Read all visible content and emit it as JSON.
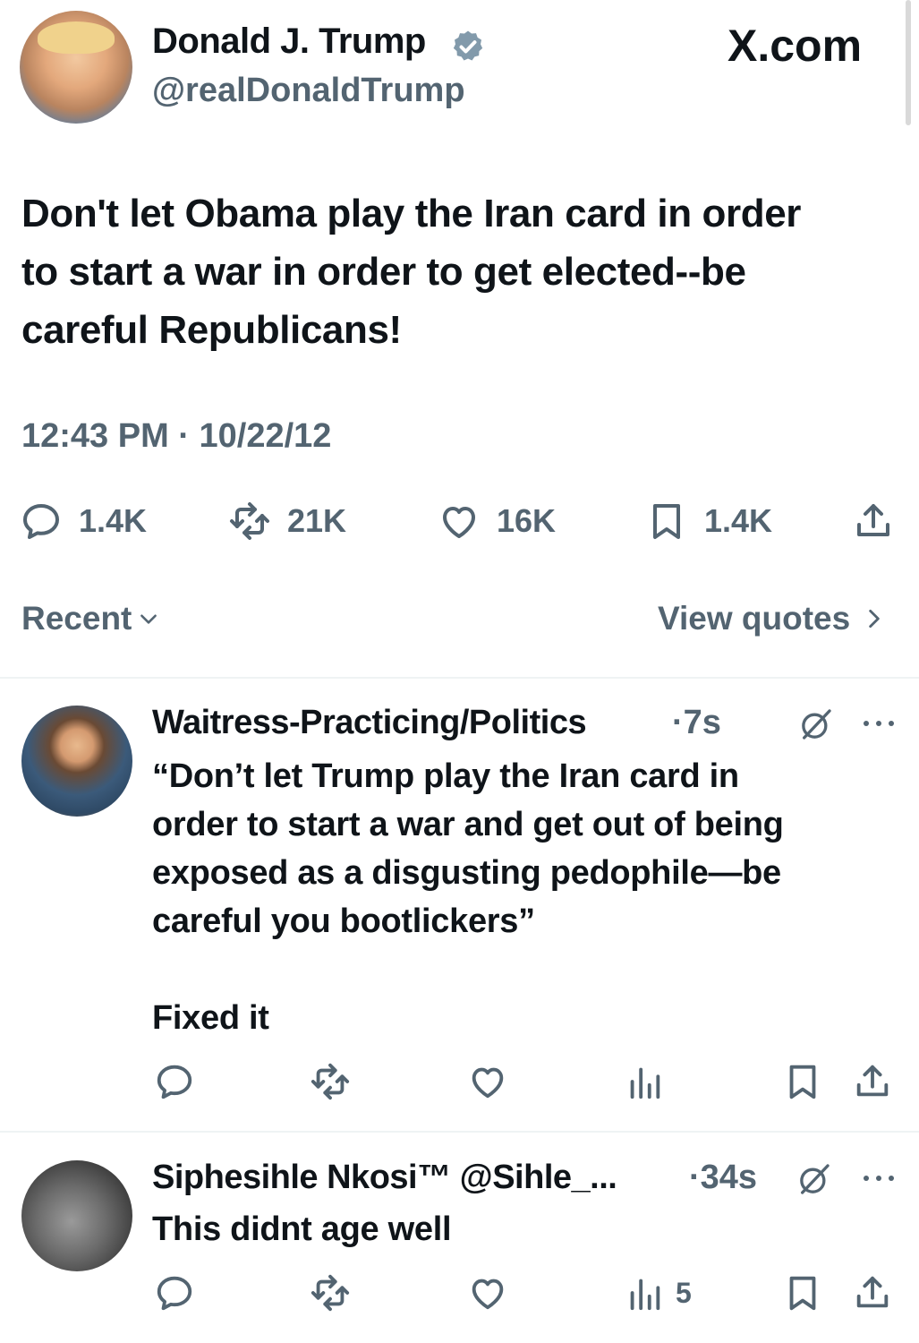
{
  "main_tweet": {
    "author_name": "Donald J. Trump",
    "handle": "@realDonaldTrump",
    "site_label": "X.com",
    "text_lines": [
      "Don't let Obama play the Iran card in order",
      "to start a war in order to get elected--be",
      "careful Republicans!"
    ],
    "timestamp": "12:43 PM · 10/22/12",
    "stats": {
      "replies": "1.4K",
      "reposts": "21K",
      "likes": "16K",
      "bookmarks": "1.4K"
    },
    "sort_label": "Recent",
    "view_quotes_label": "View quotes"
  },
  "replies": [
    {
      "name": "Waitress-Practicing/Politics",
      "time": "·7s",
      "text_lines": [
        "“Don’t let Trump play the Iran card in",
        "order to start a war and get out of being",
        "exposed as a disgusting pedophile—be",
        "careful you bootlickers”"
      ],
      "extra_line": "Fixed it",
      "views": ""
    },
    {
      "name": "Siphesihle Nkosi™ @Sihle_...",
      "time": "·34s",
      "text_lines": [
        "This didnt age well"
      ],
      "views": "5"
    }
  ],
  "icons": {
    "verified": "verified-badge-icon",
    "reply": "comment-bubble-icon",
    "repost": "repost-icon",
    "like": "heart-icon",
    "bookmark": "bookmark-icon",
    "share": "share-icon",
    "views": "bar-chart-icon",
    "grok": "grok-icon",
    "more": "more-dots-icon"
  },
  "colors": {
    "text": "#0f1419",
    "secondary": "#536471",
    "verified": "#829aab",
    "divider": "#eff3f4"
  }
}
